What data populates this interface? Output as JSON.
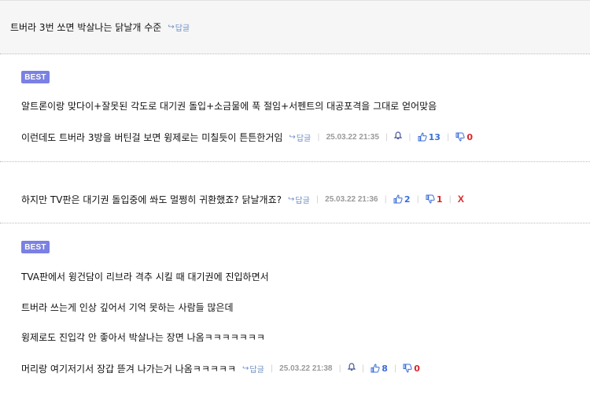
{
  "comments": [
    {
      "lines": [
        "트버라 3번 쏘면 박살나는 닭날개 수준"
      ],
      "reply_label": "답글"
    },
    {
      "badge": "BEST",
      "lines": [
        "알트론이랑 맞다이+잘못된 각도로 대기권 돌입+소금물에  푹 절임+서펜트의 대공포격을 그대로 얻어맞음",
        "이런데도 트버라 3방을 버틴걸 보면 윙제로는 미칠듯이 튼튼한거임"
      ],
      "reply_label": "답글",
      "date": "25.03.22 21:35",
      "upvotes": "13",
      "downvotes": "0"
    },
    {
      "lines": [
        "하지만 TV판은 대기권 돌입중에 쏴도 멀쩡히 귀환했죠? 닭날개죠?"
      ],
      "reply_label": "답글",
      "date": "25.03.22 21:36",
      "upvotes": "2",
      "downvotes": "1",
      "delete_label": "X"
    },
    {
      "badge": "BEST",
      "lines": [
        "TVA판에서 윙건담이 리브라 격추 시킬 때 대기권에 진입하면서",
        "트버라 쓰는게 인상 깊어서 기억 못하는 사람들 많은데",
        "윙제로도 진입각 안 좋아서 박살나는 장면 나옴ㅋㅋㅋㅋㅋㅋㅋ",
        "머리랑 여기저기서 장갑 뜯겨 나가는거 나옴ㅋㅋㅋㅋㅋ"
      ],
      "reply_label": "답글",
      "date": "25.03.22 21:38",
      "upvotes": "8",
      "downvotes": "0"
    }
  ],
  "colors": {
    "best_badge": "#7b80e3",
    "reply_link": "#6f8fc4",
    "upvote": "#3b6ed8",
    "downvote": "#d9262a"
  },
  "icons": [
    "reply-arrow-icon",
    "bell-icon",
    "thumbs-up-icon",
    "thumbs-down-icon"
  ]
}
